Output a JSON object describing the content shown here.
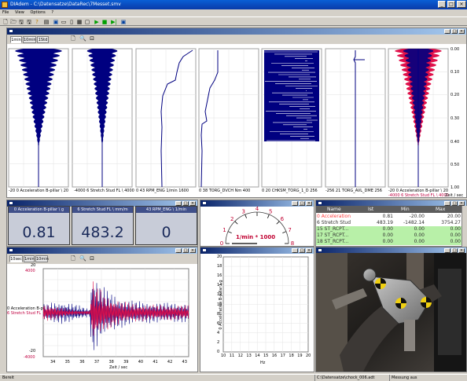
{
  "app": {
    "title": "DIAdem - C:\\Datensatze\\DataRec\\7Messet.smv"
  },
  "menu": [
    "File",
    "View",
    "Options",
    "?"
  ],
  "top_window": {
    "tabs": [
      "1min",
      "10min",
      "1Std"
    ],
    "axis_ticks": [
      "0.00",
      "0.10",
      "0.20",
      "0.30",
      "0.40",
      "0.50",
      "1.00"
    ],
    "axis_unit": "Zeit / sec",
    "channel_captions": [
      "-20  0 Acceleration B-pillar \\ 20",
      "-4000  6 Stretch Stud FL \\ 4000",
      "0  43 RPM_ENG  1/min  1600",
      "0  38 TORG_DVCH  Nm  400",
      "0  20 CHKSM_TORG_1_D  256",
      "-256  21 TORG_AVL_DME  256",
      "-20  0 Acceleration B-pillar \\ 20"
    ],
    "overlay_caption": "-4000  6 Stretch Stud FL \\ 4000"
  },
  "digital_displays": [
    {
      "label": "0 Acceleration B-pillar \\ g",
      "value": "0.81"
    },
    {
      "label": "6 Stretch Stud FL \\ mm/m",
      "value": "483.2"
    },
    {
      "label": "43 RPM_ENG \\ 1/min",
      "value": "0"
    }
  ],
  "gauge": {
    "ticks": [
      "0",
      "1",
      "2",
      "3",
      "4",
      "5",
      "6",
      "7",
      "8"
    ],
    "unit_label": "1/min * 1000",
    "value_fraction": 0.0
  },
  "table": {
    "headers": [
      "Name",
      "Ist",
      "Min",
      "Max"
    ],
    "rows": [
      {
        "name": "0 Acceleration",
        "ist": "0.81",
        "min": "-20.00",
        "max": "20.00",
        "color": "#ff4040"
      },
      {
        "name": "6 Stretch Stud",
        "ist": "483.19",
        "min": "-1482.14",
        "max": "3754.27",
        "color": "#303030"
      },
      {
        "name": "15 ST_RCPT...",
        "ist": "0.00",
        "min": "0.00",
        "max": "0.00",
        "color": "#303030"
      },
      {
        "name": "17 ST_RCPT...",
        "ist": "0.00",
        "min": "0.00",
        "max": "0.00",
        "color": "#303030"
      },
      {
        "name": "18 ST_RCPT...",
        "ist": "0.00",
        "min": "0.00",
        "max": "0.00",
        "color": "#303030"
      }
    ]
  },
  "bottom_left": {
    "tabs": [
      "10sec",
      "1min",
      "10min"
    ],
    "y_top_ticks": [
      "20",
      "4000"
    ],
    "y_bottom_ticks": [
      "-20",
      "-4000"
    ],
    "legend": [
      "0 Acceleration B-p",
      "6 Stretch Stud FL"
    ],
    "x_ticks": [
      "34",
      "35",
      "36",
      "37",
      "38",
      "39",
      "40",
      "41",
      "42",
      "43"
    ],
    "x_label": "Zeit / sec"
  },
  "bottom_mid": {
    "y_label": "0 Acceleration B-pillar \\ g",
    "y_ticks": [
      "20",
      "18",
      "16",
      "14",
      "12",
      "10",
      "8",
      "6",
      "4",
      "2",
      "0"
    ],
    "x_ticks": [
      "10",
      "11",
      "12",
      "13",
      "14",
      "15",
      "16",
      "17",
      "18",
      "19",
      "20"
    ],
    "x_label": "Hz"
  },
  "statusbar": {
    "left": "Bereit",
    "file": "C:\\Datensatze\\chock_006.adt",
    "mode": "Messung aus"
  },
  "colors": {
    "navy": "#000080",
    "red": "#e0104a",
    "highlight_green": "#b8f0a8"
  }
}
